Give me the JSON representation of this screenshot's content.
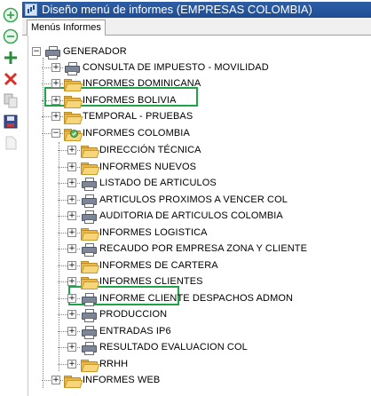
{
  "window": {
    "title": "Diseño menú de informes (EMPRESAS COLOMBIA)"
  },
  "tabs": [
    {
      "label": "Menús Informes",
      "selected": true
    }
  ],
  "toolbar": [
    {
      "name": "add-circle-icon",
      "color": "#3aa655"
    },
    {
      "name": "remove-circle-icon",
      "color": "#3aa655"
    },
    {
      "name": "add-icon",
      "color": "#2e8b3d"
    },
    {
      "name": "delete-icon",
      "color": "#d93025"
    },
    {
      "name": "copy-icon",
      "color": "#b0b0b0"
    },
    {
      "name": "save-icon",
      "color": "#3a4a8a"
    },
    {
      "name": "document-icon",
      "color": "#c8c8c8"
    }
  ],
  "highlight_color": "#1fa34a",
  "tree": {
    "root": {
      "label": "GENERADOR",
      "icon": "printer-icon",
      "expanded": true
    },
    "level1": [
      {
        "label": "CONSULTA DE IMPUESTO - MOVILIDAD",
        "icon": "printer-icon",
        "expanded": false
      },
      {
        "label": "INFORMES DOMINICANA",
        "icon": "folder-icon",
        "expanded": false
      },
      {
        "label": "INFORMES BOLIVIA",
        "icon": "folder-icon",
        "expanded": false
      },
      {
        "label": "TEMPORAL - PRUEBAS",
        "icon": "folder-icon",
        "expanded": false
      },
      {
        "label": "INFORMES COLOMBIA",
        "icon": "folder-open-icon",
        "expanded": true,
        "highlighted": true
      },
      {
        "label": "INFORMES WEB",
        "icon": "folder-icon",
        "expanded": false
      }
    ],
    "colombia_children": [
      {
        "label": "DIRECCIÓN TÉCNICA",
        "icon": "folder-icon"
      },
      {
        "label": "INFORMES NUEVOS",
        "icon": "folder-icon"
      },
      {
        "label": "LISTADO DE ARTICULOS",
        "icon": "printer-icon"
      },
      {
        "label": "ARTICULOS PROXIMOS A VENCER COL",
        "icon": "printer-icon"
      },
      {
        "label": "AUDITORIA DE ARTICULOS COLOMBIA",
        "icon": "printer-icon"
      },
      {
        "label": "INFORMES LOGISTICA",
        "icon": "folder-icon"
      },
      {
        "label": "RECAUDO POR EMPRESA ZONA Y CLIENTE",
        "icon": "printer-icon"
      },
      {
        "label": "INFORMES DE CARTERA",
        "icon": "folder-icon"
      },
      {
        "label": "INFORMES CLIENTES",
        "icon": "folder-icon"
      },
      {
        "label": "INFORME CLIENTE DESPACHOS ADMON",
        "icon": "printer-icon"
      },
      {
        "label": "PRODUCCION",
        "icon": "printer-icon"
      },
      {
        "label": "ENTRADAS IP6",
        "icon": "printer-icon",
        "highlighted": true
      },
      {
        "label": "RESULTADO EVALUACION COL",
        "icon": "printer-icon"
      },
      {
        "label": "RRHH",
        "icon": "folder-icon"
      }
    ]
  }
}
